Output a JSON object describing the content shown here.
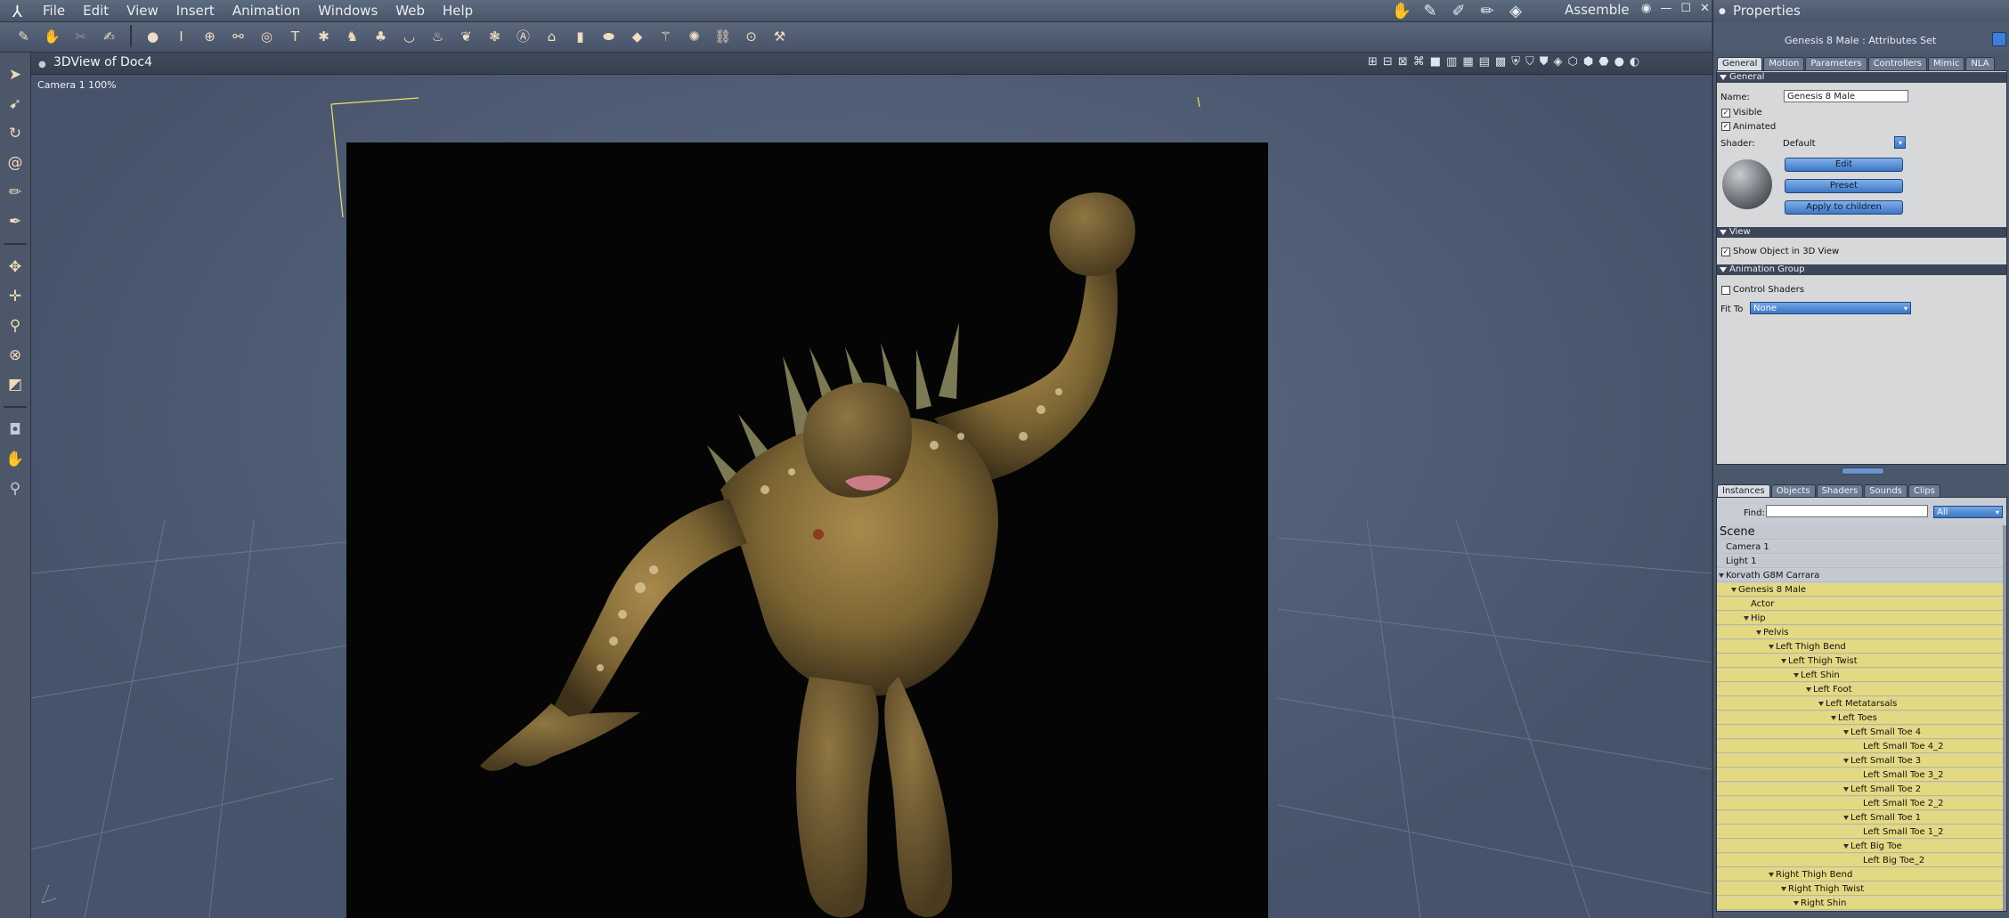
{
  "menubar": {
    "menus": [
      "File",
      "Edit",
      "View",
      "Insert",
      "Animation",
      "Windows",
      "Web",
      "Help"
    ],
    "room_label": "Assemble"
  },
  "document": {
    "title": "3DView of Doc4",
    "camera_label": "Camera 1 100%"
  },
  "properties": {
    "title": "Properties",
    "header": "Genesis 8 Male : Attributes Set",
    "tabs": [
      "General",
      "Motion",
      "Parameters",
      "Controllers",
      "Mimic",
      "NLA"
    ],
    "general": {
      "section_general": "General",
      "name_label": "Name:",
      "name_value": "Genesis 8 Male",
      "visible_label": "Visible",
      "visible_checked": true,
      "animated_label": "Animated",
      "animated_checked": true,
      "shader_label": "Shader:",
      "shader_value": "Default",
      "edit_button": "Edit",
      "preset_button": "Preset",
      "apply_button": "Apply to children",
      "section_view": "View",
      "show_object_label": "Show Object in 3D View",
      "show_object_checked": true,
      "section_animation": "Animation Group",
      "control_shaders_label": "Control Shaders",
      "control_shaders_checked": false,
      "fit_to_label": "Fit To",
      "fit_to_value": "None"
    }
  },
  "instances": {
    "tabs": [
      "Instances",
      "Objects",
      "Shaders",
      "Sounds",
      "Clips"
    ],
    "find_label": "Find:",
    "find_value": "",
    "filter_value": "All",
    "scene_label": "Scene",
    "rows": [
      {
        "label": "Camera 1",
        "depth": 0,
        "hl": false,
        "tw": false
      },
      {
        "label": "Light 1",
        "depth": 0,
        "hl": false,
        "tw": false
      },
      {
        "label": "Korvath G8M Carrara",
        "depth": 0,
        "hl": false,
        "tw": true
      },
      {
        "label": "Genesis 8 Male",
        "depth": 1,
        "hl": true,
        "tw": true
      },
      {
        "label": "Actor",
        "depth": 2,
        "hl": true,
        "tw": false
      },
      {
        "label": "Hip",
        "depth": 2,
        "hl": true,
        "tw": true
      },
      {
        "label": "Pelvis",
        "depth": 3,
        "hl": true,
        "tw": true
      },
      {
        "label": "Left Thigh Bend",
        "depth": 4,
        "hl": true,
        "tw": true
      },
      {
        "label": "Left Thigh Twist",
        "depth": 5,
        "hl": true,
        "tw": true
      },
      {
        "label": "Left Shin",
        "depth": 6,
        "hl": true,
        "tw": true
      },
      {
        "label": "Left Foot",
        "depth": 7,
        "hl": true,
        "tw": true
      },
      {
        "label": "Left Metatarsals",
        "depth": 8,
        "hl": true,
        "tw": true
      },
      {
        "label": "Left Toes",
        "depth": 9,
        "hl": true,
        "tw": true
      },
      {
        "label": "Left Small Toe 4",
        "depth": 10,
        "hl": true,
        "tw": true
      },
      {
        "label": "Left Small Toe 4_2",
        "depth": 11,
        "hl": true,
        "tw": false
      },
      {
        "label": "Left Small Toe 3",
        "depth": 10,
        "hl": true,
        "tw": true
      },
      {
        "label": "Left Small Toe 3_2",
        "depth": 11,
        "hl": true,
        "tw": false
      },
      {
        "label": "Left Small Toe 2",
        "depth": 10,
        "hl": true,
        "tw": true
      },
      {
        "label": "Left Small Toe 2_2",
        "depth": 11,
        "hl": true,
        "tw": false
      },
      {
        "label": "Left Small Toe 1",
        "depth": 10,
        "hl": true,
        "tw": true
      },
      {
        "label": "Left Small Toe 1_2",
        "depth": 11,
        "hl": true,
        "tw": false
      },
      {
        "label": "Left Big Toe",
        "depth": 10,
        "hl": true,
        "tw": true
      },
      {
        "label": "Left Big Toe_2",
        "depth": 11,
        "hl": true,
        "tw": false
      },
      {
        "label": "Right Thigh Bend",
        "depth": 4,
        "hl": true,
        "tw": true
      },
      {
        "label": "Right Thigh Twist",
        "depth": 5,
        "hl": true,
        "tw": true
      },
      {
        "label": "Right Shin",
        "depth": 6,
        "hl": true,
        "tw": true
      }
    ]
  },
  "icons": {
    "app_logo": "carrara-logo-icon",
    "toolbar": [
      "pencil-tool-icon",
      "hand-grab-icon",
      "scissors-icon",
      "sculpt-brush-icon",
      "sphere-icon",
      "pillar-icon",
      "globe-icon",
      "bone-icon",
      "torus-icon",
      "text-t-icon",
      "gear-icon",
      "figure-icon",
      "tree-icon",
      "bowl-icon",
      "vase-icon",
      "plant-icon",
      "cluster-icon",
      "agx-icon",
      "house-icon",
      "cylinder-icon",
      "egg-icon",
      "rock-icon",
      "wand-icon",
      "spider-icon",
      "chain-icon",
      "target-icon",
      "wrench-icon"
    ],
    "left_tools": [
      "arrow-select-icon",
      "arrow-select-alt-icon",
      "rotate-icon",
      "spiral-icon",
      "pencil-icon",
      "paint-icon",
      "move-icon",
      "move-all-icon",
      "bone-move-icon",
      "sphere-tool-icon",
      "box-tool-icon",
      "camera-icon",
      "hand-icon",
      "zoom-icon"
    ]
  }
}
